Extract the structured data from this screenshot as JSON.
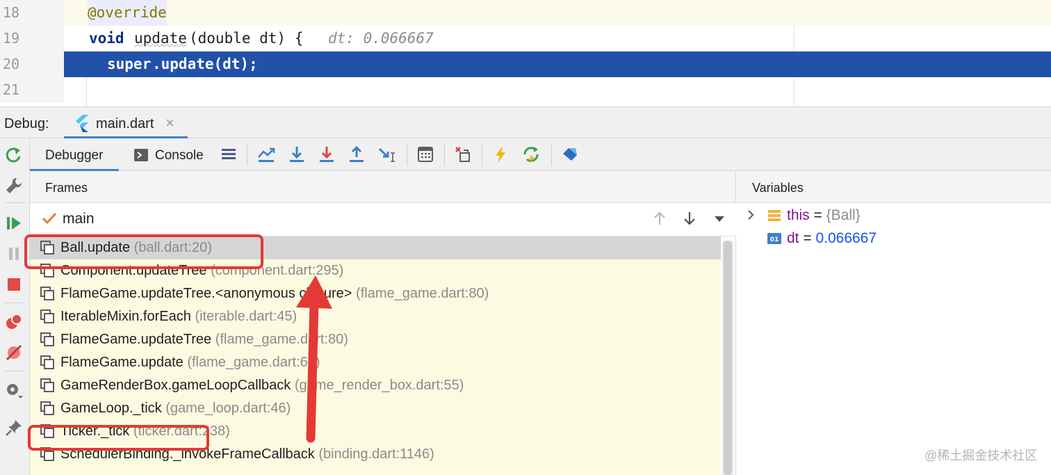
{
  "editor": {
    "lines": [
      {
        "number": "18",
        "annotation": "@override"
      },
      {
        "number": "19",
        "kw_void": "void",
        "fn_name": "update",
        "params": "(double dt) {",
        "hint": "dt: 0.066667"
      },
      {
        "number": "20",
        "kw_super": "super",
        "call": ".update(dt);"
      },
      {
        "number": "21"
      }
    ]
  },
  "debug_header": {
    "label": "Debug:",
    "tab_label": "main.dart",
    "close_glyph": "×"
  },
  "toolbar": {
    "tabs": [
      {
        "label": "Debugger",
        "selected": true
      },
      {
        "label": "Console",
        "selected": false
      }
    ]
  },
  "frames": {
    "title": "Frames",
    "thread": "main",
    "items": [
      {
        "method": "Ball.update",
        "location": "(ball.dart:20)",
        "selected": true
      },
      {
        "method": "Component.updateTree",
        "location": "(component.dart:295)"
      },
      {
        "method": "FlameGame.updateTree.<anonymous closure>",
        "location": "(flame_game.dart:80)"
      },
      {
        "method": "IterableMixin.forEach",
        "location": "(iterable.dart:45)"
      },
      {
        "method": "FlameGame.updateTree",
        "location": "(flame_game.dart:80)"
      },
      {
        "method": "FlameGame.update",
        "location": "(flame_game.dart:69)"
      },
      {
        "method": "GameRenderBox.gameLoopCallback",
        "location": "(game_render_box.dart:55)"
      },
      {
        "method": "GameLoop._tick",
        "location": "(game_loop.dart:46)"
      },
      {
        "method": "Ticker._tick",
        "location": "(ticker.dart:238)"
      },
      {
        "method": "SchedulerBinding._invokeFrameCallback",
        "location": "(binding.dart:1146)"
      }
    ]
  },
  "variables": {
    "title": "Variables",
    "items": [
      {
        "name": "this",
        "eq": " = ",
        "value": "{Ball}",
        "kind": "object"
      },
      {
        "name": "dt",
        "eq": " = ",
        "value": "0.066667",
        "kind": "number",
        "badge": "01"
      }
    ]
  },
  "watermark": "@稀土掘金技术社区",
  "colors": {
    "execution_line": "#2151a8",
    "frames_background": "#fcfbe1",
    "annotation_red": "#e53935",
    "tab_underline": "#4083c9"
  }
}
